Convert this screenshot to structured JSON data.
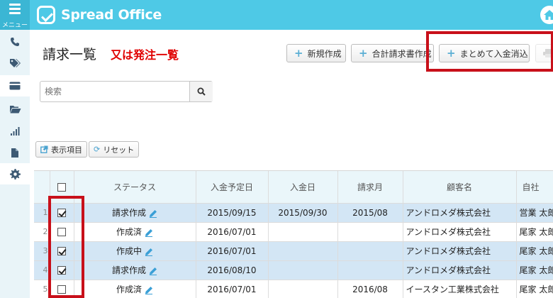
{
  "header": {
    "menu_label": "メニュー",
    "logo_text": "Spread Office"
  },
  "colors": {
    "header_bg": "#4ec9e6",
    "sidebar_bg": "#e9f4f8",
    "selected_row": "#d3e6f5",
    "highlight": "#c8101a",
    "subtitle": "#e00000"
  },
  "sidebar": {
    "items": [
      {
        "icon": "phone-icon"
      },
      {
        "icon": "tag-icon"
      },
      {
        "icon": "credit-card-icon"
      },
      {
        "icon": "folder-open-icon"
      },
      {
        "icon": "bar-chart-icon"
      },
      {
        "icon": "file-icon"
      },
      {
        "icon": "gear-icon"
      }
    ]
  },
  "page": {
    "title": "請求一覧",
    "subtitle": "又は発注一覧"
  },
  "toolbar": {
    "new_label": "新規作成",
    "total_invoice_label": "合計請求書作成",
    "bulk_payment_label": "まとめて入金消込"
  },
  "search": {
    "placeholder": "検索"
  },
  "controls": {
    "display_items_label": "表示項目",
    "reset_label": "リセット"
  },
  "table": {
    "columns": [
      "ステータス",
      "入金予定日",
      "入金日",
      "請求月",
      "顧客名",
      "自社"
    ],
    "rows": [
      {
        "num": "1",
        "checked": true,
        "status": "請求作成",
        "due": "2015/09/15",
        "paid": "2015/09/30",
        "month": "2015/08",
        "customer": "アンドロメダ株式会社",
        "owner": "営業 太郎"
      },
      {
        "num": "2",
        "checked": false,
        "status": "作成済",
        "due": "2016/07/01",
        "paid": "",
        "month": "",
        "customer": "アンドロメダ株式会社",
        "owner": "尾家 太郎"
      },
      {
        "num": "3",
        "checked": true,
        "status": "作成中",
        "due": "2016/07/01",
        "paid": "",
        "month": "",
        "customer": "アンドロメダ株式会社",
        "owner": "尾家 太郎"
      },
      {
        "num": "4",
        "checked": true,
        "status": "請求作成",
        "due": "2016/08/10",
        "paid": "",
        "month": "",
        "customer": "アンドロメダ株式会社",
        "owner": "尾家 太郎"
      },
      {
        "num": "5",
        "checked": false,
        "status": "作成済",
        "due": "2016/07/01",
        "paid": "",
        "month": "2016/08",
        "customer": "イースタン工業株式会社",
        "owner": "尾家 太郎"
      }
    ]
  }
}
